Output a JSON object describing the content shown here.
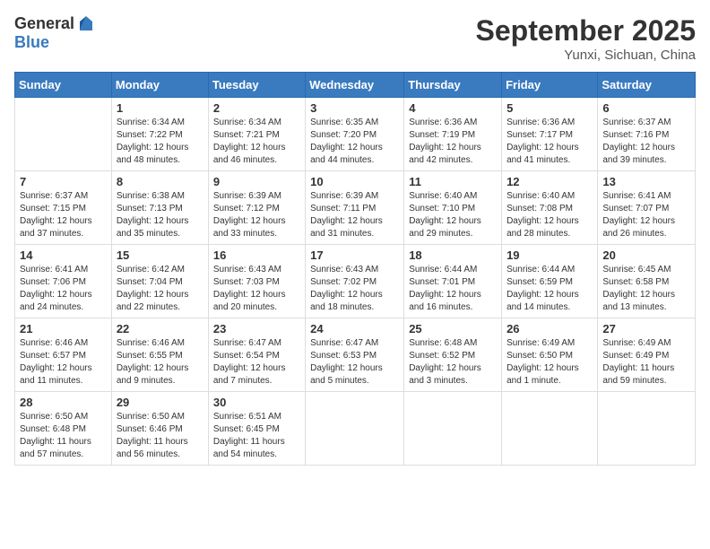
{
  "header": {
    "logo_general": "General",
    "logo_blue": "Blue",
    "title": "September 2025",
    "location": "Yunxi, Sichuan, China"
  },
  "days_of_week": [
    "Sunday",
    "Monday",
    "Tuesday",
    "Wednesday",
    "Thursday",
    "Friday",
    "Saturday"
  ],
  "weeks": [
    [
      {
        "day": "",
        "info": ""
      },
      {
        "day": "1",
        "info": "Sunrise: 6:34 AM\nSunset: 7:22 PM\nDaylight: 12 hours\nand 48 minutes."
      },
      {
        "day": "2",
        "info": "Sunrise: 6:34 AM\nSunset: 7:21 PM\nDaylight: 12 hours\nand 46 minutes."
      },
      {
        "day": "3",
        "info": "Sunrise: 6:35 AM\nSunset: 7:20 PM\nDaylight: 12 hours\nand 44 minutes."
      },
      {
        "day": "4",
        "info": "Sunrise: 6:36 AM\nSunset: 7:19 PM\nDaylight: 12 hours\nand 42 minutes."
      },
      {
        "day": "5",
        "info": "Sunrise: 6:36 AM\nSunset: 7:17 PM\nDaylight: 12 hours\nand 41 minutes."
      },
      {
        "day": "6",
        "info": "Sunrise: 6:37 AM\nSunset: 7:16 PM\nDaylight: 12 hours\nand 39 minutes."
      }
    ],
    [
      {
        "day": "7",
        "info": "Sunrise: 6:37 AM\nSunset: 7:15 PM\nDaylight: 12 hours\nand 37 minutes."
      },
      {
        "day": "8",
        "info": "Sunrise: 6:38 AM\nSunset: 7:13 PM\nDaylight: 12 hours\nand 35 minutes."
      },
      {
        "day": "9",
        "info": "Sunrise: 6:39 AM\nSunset: 7:12 PM\nDaylight: 12 hours\nand 33 minutes."
      },
      {
        "day": "10",
        "info": "Sunrise: 6:39 AM\nSunset: 7:11 PM\nDaylight: 12 hours\nand 31 minutes."
      },
      {
        "day": "11",
        "info": "Sunrise: 6:40 AM\nSunset: 7:10 PM\nDaylight: 12 hours\nand 29 minutes."
      },
      {
        "day": "12",
        "info": "Sunrise: 6:40 AM\nSunset: 7:08 PM\nDaylight: 12 hours\nand 28 minutes."
      },
      {
        "day": "13",
        "info": "Sunrise: 6:41 AM\nSunset: 7:07 PM\nDaylight: 12 hours\nand 26 minutes."
      }
    ],
    [
      {
        "day": "14",
        "info": "Sunrise: 6:41 AM\nSunset: 7:06 PM\nDaylight: 12 hours\nand 24 minutes."
      },
      {
        "day": "15",
        "info": "Sunrise: 6:42 AM\nSunset: 7:04 PM\nDaylight: 12 hours\nand 22 minutes."
      },
      {
        "day": "16",
        "info": "Sunrise: 6:43 AM\nSunset: 7:03 PM\nDaylight: 12 hours\nand 20 minutes."
      },
      {
        "day": "17",
        "info": "Sunrise: 6:43 AM\nSunset: 7:02 PM\nDaylight: 12 hours\nand 18 minutes."
      },
      {
        "day": "18",
        "info": "Sunrise: 6:44 AM\nSunset: 7:01 PM\nDaylight: 12 hours\nand 16 minutes."
      },
      {
        "day": "19",
        "info": "Sunrise: 6:44 AM\nSunset: 6:59 PM\nDaylight: 12 hours\nand 14 minutes."
      },
      {
        "day": "20",
        "info": "Sunrise: 6:45 AM\nSunset: 6:58 PM\nDaylight: 12 hours\nand 13 minutes."
      }
    ],
    [
      {
        "day": "21",
        "info": "Sunrise: 6:46 AM\nSunset: 6:57 PM\nDaylight: 12 hours\nand 11 minutes."
      },
      {
        "day": "22",
        "info": "Sunrise: 6:46 AM\nSunset: 6:55 PM\nDaylight: 12 hours\nand 9 minutes."
      },
      {
        "day": "23",
        "info": "Sunrise: 6:47 AM\nSunset: 6:54 PM\nDaylight: 12 hours\nand 7 minutes."
      },
      {
        "day": "24",
        "info": "Sunrise: 6:47 AM\nSunset: 6:53 PM\nDaylight: 12 hours\nand 5 minutes."
      },
      {
        "day": "25",
        "info": "Sunrise: 6:48 AM\nSunset: 6:52 PM\nDaylight: 12 hours\nand 3 minutes."
      },
      {
        "day": "26",
        "info": "Sunrise: 6:49 AM\nSunset: 6:50 PM\nDaylight: 12 hours\nand 1 minute."
      },
      {
        "day": "27",
        "info": "Sunrise: 6:49 AM\nSunset: 6:49 PM\nDaylight: 11 hours\nand 59 minutes."
      }
    ],
    [
      {
        "day": "28",
        "info": "Sunrise: 6:50 AM\nSunset: 6:48 PM\nDaylight: 11 hours\nand 57 minutes."
      },
      {
        "day": "29",
        "info": "Sunrise: 6:50 AM\nSunset: 6:46 PM\nDaylight: 11 hours\nand 56 minutes."
      },
      {
        "day": "30",
        "info": "Sunrise: 6:51 AM\nSunset: 6:45 PM\nDaylight: 11 hours\nand 54 minutes."
      },
      {
        "day": "",
        "info": ""
      },
      {
        "day": "",
        "info": ""
      },
      {
        "day": "",
        "info": ""
      },
      {
        "day": "",
        "info": ""
      }
    ]
  ]
}
